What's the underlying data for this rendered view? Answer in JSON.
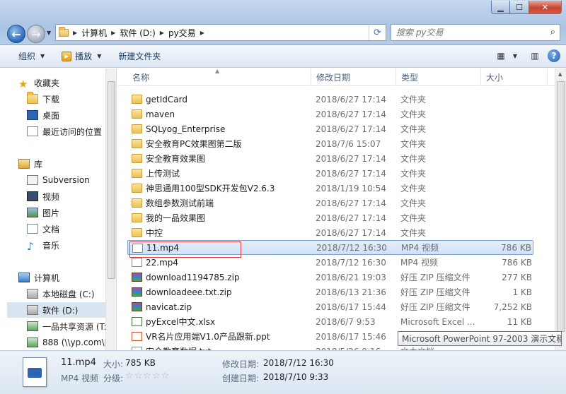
{
  "address": {
    "crumbs": [
      "计算机",
      "软件 (D:)",
      "py交易"
    ],
    "search_placeholder": "搜索 py交易"
  },
  "toolbar": {
    "organize": "组织",
    "play": "播放",
    "new_folder": "新建文件夹"
  },
  "nav": {
    "favorites": "收藏夹",
    "download": "下载",
    "desktop": "桌面",
    "recent": "最近访问的位置",
    "libraries": "库",
    "subversion": "Subversion",
    "videos": "视频",
    "pictures": "图片",
    "documents": "文档",
    "music": "音乐",
    "computer": "计算机",
    "drive_c": "本地磁盘 (C:)",
    "drive_d": "软件 (D:)",
    "share": "一品共享资源 (T:",
    "net_888": "888 (\\\\yp.com\\["
  },
  "columns": {
    "name": "名称",
    "date": "修改日期",
    "type": "类型",
    "size": "大小"
  },
  "files": [
    {
      "name": "getIdCard",
      "date": "2018/6/27 17:14",
      "type": "文件夹",
      "size": "",
      "icon": "folder"
    },
    {
      "name": "maven",
      "date": "2018/6/27 17:14",
      "type": "文件夹",
      "size": "",
      "icon": "folder"
    },
    {
      "name": "SQLyog_Enterprise",
      "date": "2018/6/27 17:14",
      "type": "文件夹",
      "size": "",
      "icon": "folder"
    },
    {
      "name": "安全教育PC效果图第二版",
      "date": "2018/7/6 15:07",
      "type": "文件夹",
      "size": "",
      "icon": "folder"
    },
    {
      "name": "安全教育效果图",
      "date": "2018/6/27 17:14",
      "type": "文件夹",
      "size": "",
      "icon": "folder"
    },
    {
      "name": "上传测试",
      "date": "2018/6/27 17:14",
      "type": "文件夹",
      "size": "",
      "icon": "folder"
    },
    {
      "name": "神思通用100型SDK开发包V2.6.3",
      "date": "2018/1/19 10:54",
      "type": "文件夹",
      "size": "",
      "icon": "folder"
    },
    {
      "name": "数组参数测试前端",
      "date": "2018/6/27 17:14",
      "type": "文件夹",
      "size": "",
      "icon": "folder"
    },
    {
      "name": "我的一品效果图",
      "date": "2018/6/27 17:14",
      "type": "文件夹",
      "size": "",
      "icon": "folder"
    },
    {
      "name": "中控",
      "date": "2018/6/27 17:14",
      "type": "文件夹",
      "size": "",
      "icon": "folder"
    },
    {
      "name": "11.mp4",
      "date": "2018/7/12 16:30",
      "type": "MP4 视频",
      "size": "786 KB",
      "icon": "mp4"
    },
    {
      "name": "22.mp4",
      "date": "2018/7/12 16:30",
      "type": "MP4 视频",
      "size": "786 KB",
      "icon": "mp4"
    },
    {
      "name": "download1194785.zip",
      "date": "2018/6/21 19:03",
      "type": "好压 ZIP 压缩文件",
      "size": "277 KB",
      "icon": "zip"
    },
    {
      "name": "downloadeee.txt.zip",
      "date": "2018/6/13 21:36",
      "type": "好压 ZIP 压缩文件",
      "size": "1 KB",
      "icon": "zip"
    },
    {
      "name": "navicat.zip",
      "date": "2018/6/17 15:44",
      "type": "好压 ZIP 压缩文件",
      "size": "7,252 KB",
      "icon": "zip"
    },
    {
      "name": "pyExcel中文.xlsx",
      "date": "2018/6/7 9:53",
      "type": "Microsoft Excel ...",
      "size": "11 KB",
      "icon": "xlsx"
    },
    {
      "name": "VR名片应用端V1.0产品跟新.ppt",
      "date": "2018/6/17 15:46",
      "type": "",
      "size": "",
      "icon": "ppt"
    },
    {
      "name": "安全教育数据.txt",
      "date": "2018/5/26 9:16",
      "type": "文本文档",
      "size": "",
      "icon": "txt"
    }
  ],
  "tooltip": "Microsoft PowerPoint 97-2003 演示文稿",
  "details": {
    "filename": "11.mp4",
    "size_label": "大小:",
    "size_value": "785 KB",
    "type": "MP4 视频",
    "rating_label": "分级:",
    "modified_label": "修改日期:",
    "modified_value": "2018/7/12 16:30",
    "created_label": "创建日期:",
    "created_value": "2018/7/10 9:33",
    "stars": "☆☆☆☆☆"
  }
}
